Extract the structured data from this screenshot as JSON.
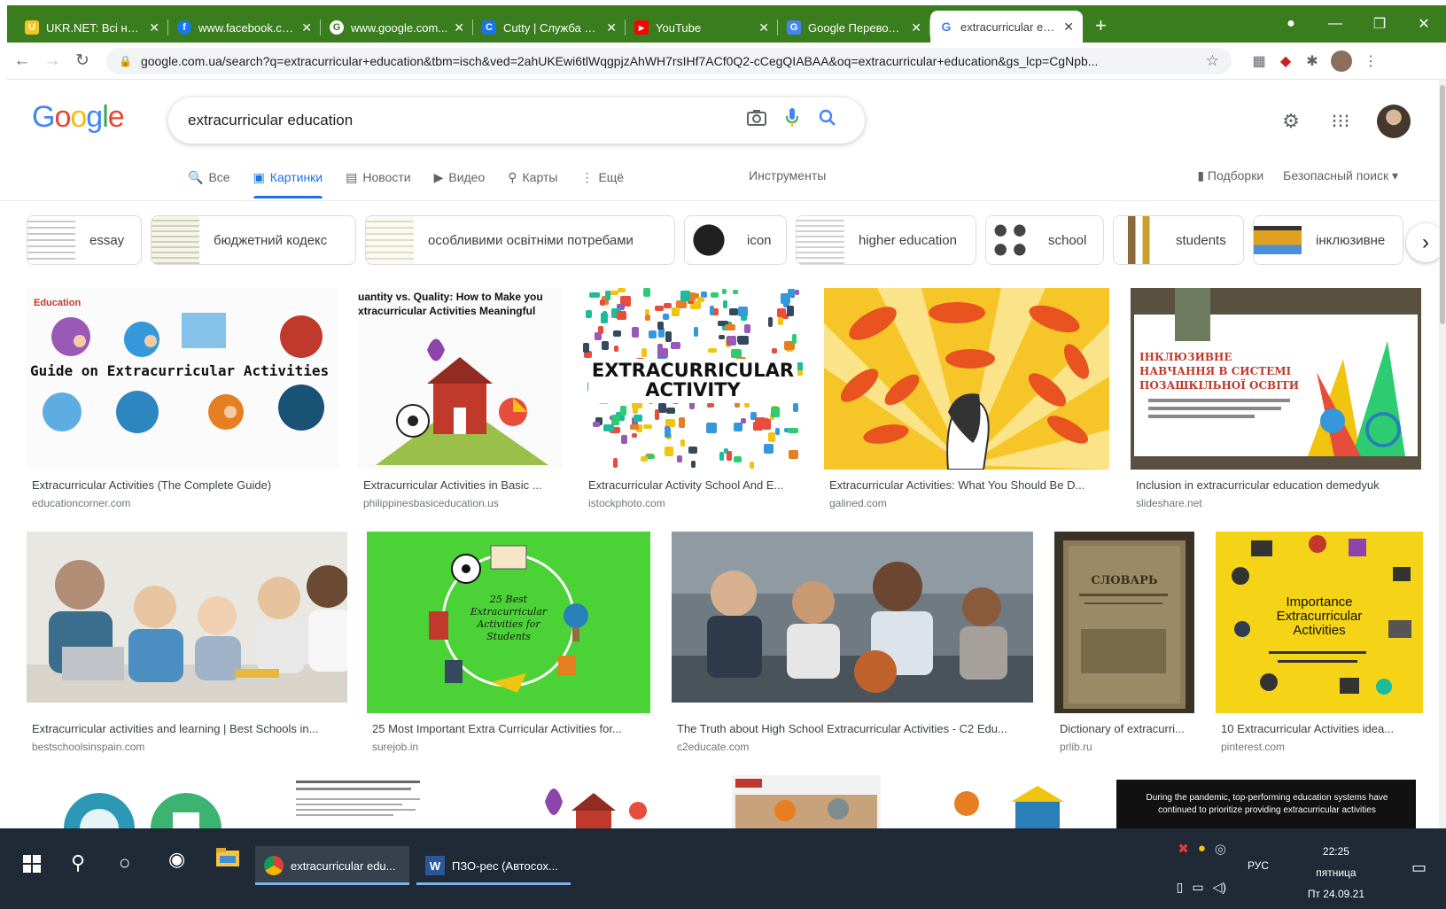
{
  "browser": {
    "tabs": [
      {
        "label": "UKR.NET: Всі нови...",
        "icon": "ukrnet-icon",
        "color": "#f3c623",
        "glyph": "U"
      },
      {
        "label": "www.facebook.com",
        "icon": "facebook-icon",
        "color": "#1877f2",
        "glyph": "f"
      },
      {
        "label": "www.google.com...",
        "icon": "globe-icon",
        "color": "#5f6368",
        "glyph": "G"
      },
      {
        "label": "Cutty | Служба зн...",
        "icon": "cutty-icon",
        "color": "#1a73e8",
        "glyph": "C"
      },
      {
        "label": "YouTube",
        "icon": "youtube-icon",
        "color": "#ff0000",
        "glyph": "▶"
      },
      {
        "label": "Google Переводч...",
        "icon": "translate-icon",
        "color": "#4285f4",
        "glyph": "G"
      },
      {
        "label": "extracurricular edu...",
        "icon": "google-icon",
        "color": "#ffffff",
        "glyph": "G",
        "active": true
      }
    ],
    "new_tab": "+",
    "url": "google.com.ua/search?q=extracurricular+education&tbm=isch&ved=2ahUKEwi6tlWqgpjzAhWH7rsIHf7ACf0Q2-cCegQIABAA&oq=extracurricular+education&gs_lcp=CgNpb..."
  },
  "google": {
    "logo": [
      {
        "ch": "G",
        "color": "#4285f4"
      },
      {
        "ch": "o",
        "color": "#ea4335"
      },
      {
        "ch": "o",
        "color": "#fbbc05"
      },
      {
        "ch": "g",
        "color": "#4285f4"
      },
      {
        "ch": "l",
        "color": "#34a853"
      },
      {
        "ch": "e",
        "color": "#ea4335"
      }
    ],
    "query": "extracurricular education",
    "tabs": [
      {
        "label": "Все",
        "icon": "🔍",
        "active": false
      },
      {
        "label": "Картинки",
        "icon": "▣",
        "active": true
      },
      {
        "label": "Новости",
        "icon": "▤",
        "active": false
      },
      {
        "label": "Видео",
        "icon": "▶",
        "active": false
      },
      {
        "label": "Карты",
        "icon": "⚲",
        "active": false
      },
      {
        "label": "Ещё",
        "icon": "⋮",
        "active": false
      }
    ],
    "tools": "Инструменты",
    "collections": "Подборки",
    "safesearch": "Безопасный поиск ▾"
  },
  "chips": [
    {
      "label": "essay",
      "color": "#c8c8c8"
    },
    {
      "label": "бюджетний кодекс",
      "color": "#dcdcc8"
    },
    {
      "label": "особливими освітніми потребами",
      "color": "#e8e8d8"
    },
    {
      "label": "icon",
      "color": "#202020"
    },
    {
      "label": "higher education",
      "color": "#d0d0d0"
    },
    {
      "label": "school",
      "color": "#444444"
    },
    {
      "label": "students",
      "color": "#8a6a3c"
    },
    {
      "label": "інклюзивне",
      "color": "#e0a020"
    }
  ],
  "results": [
    {
      "title": "Extracurricular Activities (The Complete Guide)",
      "source": "educationcorner.com",
      "overlay": "Guide on Extracurricular Activities"
    },
    {
      "title": "Extracurricular Activities in Basic ...",
      "source": "philippinesbasiceducation.us",
      "overlay": "uantity vs. Quality: How to Make you xtracurricular Activities Meaningful"
    },
    {
      "title": "Extracurricular Activity School And E...",
      "source": "istockphoto.com",
      "overlay": "EXTRACURRICULAR ACTIVITY"
    },
    {
      "title": "Extracurricular Activities: What You Should Be D...",
      "source": "galined.com",
      "overlay": ""
    },
    {
      "title": "Inclusion in extracurricular education demedyuk",
      "source": "slideshare.net",
      "overlay": "ІНКЛЮЗИВНЕ НАВЧАННЯ В СИСТЕМІ ПОЗАШКІЛЬНОЇ ОСВІТИ"
    },
    {
      "title": "Extracurricular activities and learning | Best Schools in...",
      "source": "bestschoolsinspain.com",
      "overlay": ""
    },
    {
      "title": "25 Most Important Extra Curricular Activities for...",
      "source": "surejob.in",
      "overlay": "25 Best Extracurricular Activities for Students"
    },
    {
      "title": "The Truth about High School Extracurricular Activities - C2 Edu...",
      "source": "c2educate.com",
      "overlay": ""
    },
    {
      "title": "Dictionary of extracurri...",
      "source": "prlib.ru",
      "overlay": "СЛОВАРЬ"
    },
    {
      "title": "10 Extracurricular Activities idea...",
      "source": "pinterest.com",
      "overlay": "Importance Extracurricular Activities"
    },
    {
      "overlay": ""
    },
    {
      "overlay": ""
    },
    {
      "overlay": ""
    },
    {
      "overlay": ""
    },
    {
      "overlay": ""
    },
    {
      "overlay": "During the pandemic, top-performing education systems have continued to prioritize providing extracurricular activities"
    }
  ],
  "taskbar": {
    "apps": [
      {
        "label": "extracurricular edu..."
      },
      {
        "label": "ПЗО-рес (Автосох..."
      }
    ],
    "lang": "РУС",
    "time": "22:25",
    "day": "пятница",
    "date": "Пт 24.09.21"
  }
}
